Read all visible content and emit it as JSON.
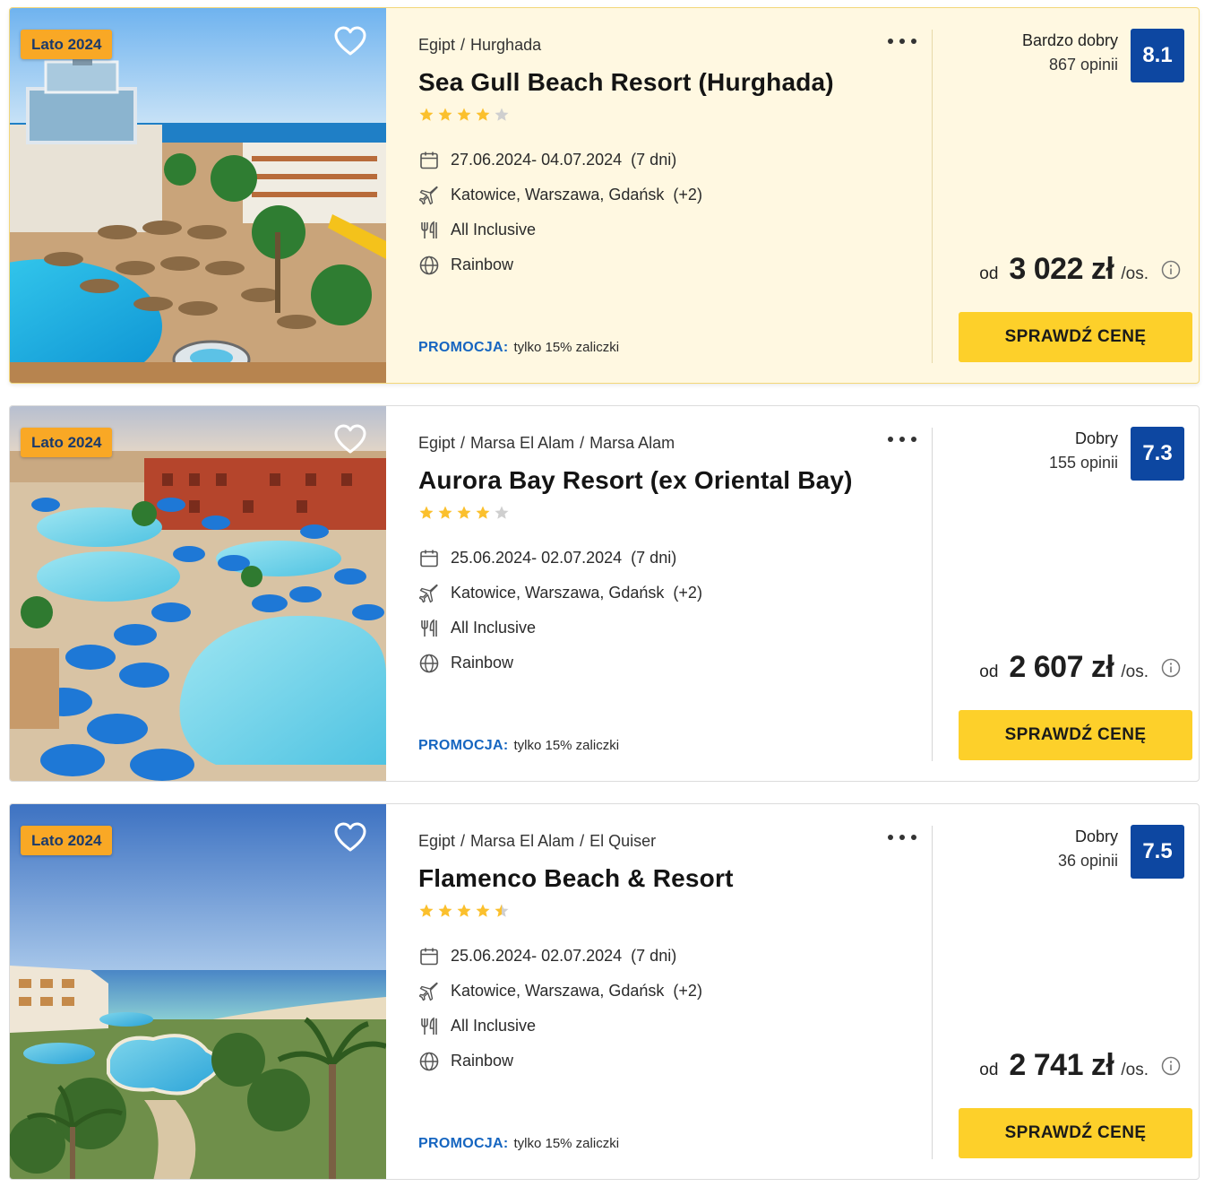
{
  "offers": [
    {
      "badge": "Lato 2024",
      "crumbs": [
        "Egipt",
        "Hurghada"
      ],
      "name": "Sea Gull Beach Resort (Hurghada)",
      "stars": 4,
      "dates": "27.06.2024- 04.07.2024",
      "days": "(7 dni)",
      "departures": "Katowice, Warszawa, Gdańsk",
      "departures_more": "(+2)",
      "board": "All Inclusive",
      "operator": "Rainbow",
      "promo_label": "PROMOCJA:",
      "promo_text": "tylko 15% zaliczki",
      "rating_label": "Bardzo dobry",
      "reviews": "867 opinii",
      "score": "8.1",
      "price_prefix": "od",
      "price": "3 022 zł",
      "price_suffix": "/os.",
      "cta": "SPRAWDŹ CENĘ",
      "highlighted": true
    },
    {
      "badge": "Lato 2024",
      "crumbs": [
        "Egipt",
        "Marsa El Alam",
        "Marsa Alam"
      ],
      "name": "Aurora Bay Resort (ex Oriental Bay)",
      "stars": 4,
      "dates": "25.06.2024- 02.07.2024",
      "days": "(7 dni)",
      "departures": "Katowice, Warszawa, Gdańsk",
      "departures_more": "(+2)",
      "board": "All Inclusive",
      "operator": "Rainbow",
      "promo_label": "PROMOCJA:",
      "promo_text": "tylko 15% zaliczki",
      "rating_label": "Dobry",
      "reviews": "155 opinii",
      "score": "7.3",
      "price_prefix": "od",
      "price": "2 607 zł",
      "price_suffix": "/os.",
      "cta": "SPRAWDŹ CENĘ",
      "highlighted": false
    },
    {
      "badge": "Lato 2024",
      "crumbs": [
        "Egipt",
        "Marsa El Alam",
        "El Quiser"
      ],
      "name": "Flamenco Beach & Resort",
      "stars": 4.5,
      "dates": "25.06.2024- 02.07.2024",
      "days": "(7 dni)",
      "departures": "Katowice, Warszawa, Gdańsk",
      "departures_more": "(+2)",
      "board": "All Inclusive",
      "operator": "Rainbow",
      "promo_label": "PROMOCJA:",
      "promo_text": "tylko 15% zaliczki",
      "rating_label": "Dobry",
      "reviews": "36 opinii",
      "score": "7.5",
      "price_prefix": "od",
      "price": "2 741 zł",
      "price_suffix": "/os.",
      "cta": "SPRAWDŹ CENĘ",
      "highlighted": false
    }
  ],
  "icons": {
    "favorite": "heart-outline-icon",
    "more": "more-dots-icon",
    "dates": "calendar-icon",
    "departures": "airplane-icon",
    "board": "cutlery-icon",
    "operator": "globe-icon",
    "price_info": "info-icon"
  },
  "colors": {
    "badge": "#f9a825",
    "score": "#0d47a1",
    "cta": "#fdd02a",
    "promo": "#1565c0",
    "star": "#fbc02d",
    "star_empty": "#cfcfcf",
    "highlight_bg": "#fff8e1"
  }
}
